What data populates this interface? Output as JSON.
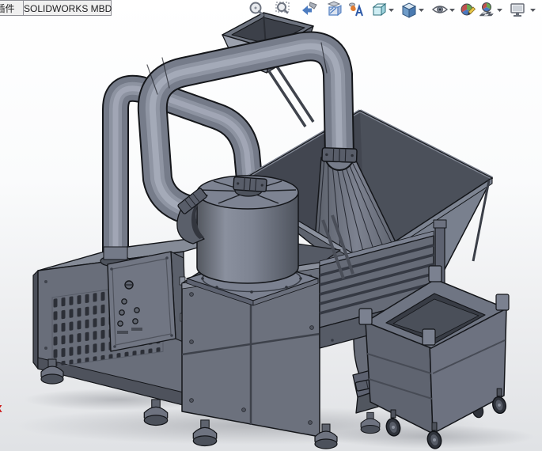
{
  "command_tabs": {
    "addins": {
      "label": "插件",
      "partially_visible": true
    },
    "mbd": {
      "label": "SOLIDWORKS MBD"
    }
  },
  "heads_up_toolbar": {
    "icons": [
      {
        "name": "zoom-to-fit",
        "dropdown": false
      },
      {
        "name": "zoom-to-area",
        "dropdown": false
      },
      {
        "name": "previous-view",
        "dropdown": false
      },
      {
        "name": "section-view",
        "dropdown": false
      },
      {
        "name": "dynamic-annotation-views",
        "dropdown": false
      },
      {
        "name": "view-orientation",
        "dropdown": true
      },
      {
        "name": "display-style",
        "dropdown": true
      },
      {
        "name": "hide-show-items",
        "dropdown": true
      },
      {
        "name": "edit-appearance",
        "dropdown": false
      },
      {
        "name": "apply-scene",
        "dropdown": true
      },
      {
        "name": "view-settings",
        "dropdown": true
      }
    ]
  },
  "viewport": {
    "triad": {
      "x_label": "X",
      "color": "#cc1111"
    },
    "background": {
      "top": "#ffffff",
      "bottom": "#e0e2e5"
    },
    "model": {
      "palette": {
        "outline": "#15171b",
        "face_front": "#6b707c",
        "face_top": "#868b98",
        "face_side": "#585d68",
        "pipe": "#767c8a",
        "pipe_highlight": "#a3a9b7",
        "inner_dark": "#454952",
        "grille": "#2c2f37"
      },
      "components": [
        "feed-chute",
        "overhead-duct-to-hopper",
        "overhead-duct-to-cabinet",
        "collection-hopper",
        "cyclone-separator",
        "blower-cabinet",
        "control-panel",
        "main-cabinet",
        "vibrating-screen",
        "discharge-chute",
        "collection-cart",
        "leveling-feet",
        "caster-wheels"
      ]
    }
  }
}
